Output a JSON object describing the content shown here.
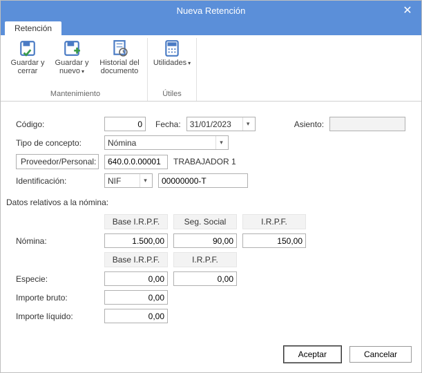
{
  "title": "Nueva Retención",
  "tab": "Retención",
  "ribbon": {
    "groups": [
      {
        "label": "Mantenimiento",
        "items": [
          {
            "label": "Guardar y cerrar"
          },
          {
            "label": "Guardar y nuevo",
            "dropdown": true
          },
          {
            "label": "Historial del documento"
          }
        ]
      },
      {
        "label": "Útiles",
        "items": [
          {
            "label": "Utilidades",
            "dropdown": true
          }
        ]
      }
    ]
  },
  "fields": {
    "codigo_label": "Código:",
    "codigo": "0",
    "fecha_label": "Fecha:",
    "fecha": "31/01/2023",
    "asiento_label": "Asiento:",
    "asiento": "",
    "tipo_label": "Tipo de concepto:",
    "tipo": "Nómina",
    "proveedor_btn": "Proveedor/Personal:",
    "proveedor_code": "640.0.0.00001",
    "proveedor_name": "TRABAJADOR 1",
    "ident_label": "Identificación:",
    "ident_type": "NIF",
    "ident_value": "00000000-T"
  },
  "nomina": {
    "section": "Datos relativos a la nómina:",
    "headers1": {
      "base": "Base I.R.P.F.",
      "seg": "Seg. Social",
      "irpf": "I.R.P.F."
    },
    "nomina_label": "Nómina:",
    "nomina_base": "1.500,00",
    "nomina_seg": "90,00",
    "nomina_irpf": "150,00",
    "headers2": {
      "base": "Base I.R.P.F.",
      "irpf": "I.R.P.F."
    },
    "especie_label": "Especie:",
    "especie_base": "0,00",
    "especie_irpf": "0,00",
    "bruto_label": "Importe bruto:",
    "bruto": "0,00",
    "liquido_label": "Importe líquido:",
    "liquido": "0,00"
  },
  "buttons": {
    "accept": "Aceptar",
    "cancel": "Cancelar"
  }
}
